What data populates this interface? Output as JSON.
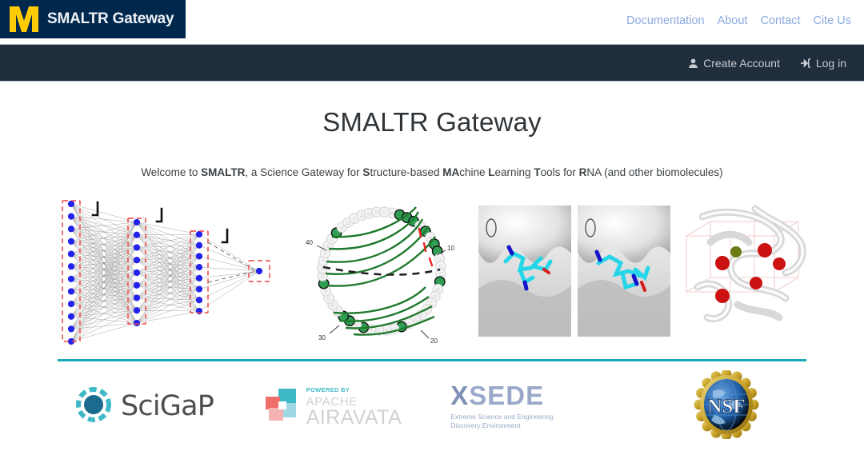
{
  "brand": {
    "logo_icon": "michigan-block-m-icon",
    "logo_text": "SMALTR Gateway",
    "navy": "#00274C",
    "maize": "#FFCB05"
  },
  "topnav": {
    "links": [
      {
        "label": "Documentation",
        "name": "documentation"
      },
      {
        "label": "About",
        "name": "about"
      },
      {
        "label": "Contact",
        "name": "contact"
      },
      {
        "label": "Cite Us",
        "name": "cite-us"
      }
    ],
    "link_color": "#8aa9e0"
  },
  "darknav": {
    "background": "#1f2d3d",
    "items": [
      {
        "label": "Create Account",
        "icon": "user-icon",
        "name": "create-account"
      },
      {
        "label": "Log in",
        "icon": "sign-in-icon",
        "name": "log-in"
      }
    ]
  },
  "main": {
    "page_title": "SMALTR Gateway",
    "welcome": {
      "parts": [
        {
          "text": "Welcome to ",
          "bold": false
        },
        {
          "text": "SMALTR",
          "bold": true
        },
        {
          "text": ", a Science Gateway for ",
          "bold": false
        },
        {
          "text": "S",
          "bold": true
        },
        {
          "text": "tructure-based ",
          "bold": false
        },
        {
          "text": "MA",
          "bold": true
        },
        {
          "text": "chine ",
          "bold": false
        },
        {
          "text": "L",
          "bold": true
        },
        {
          "text": "earning ",
          "bold": false
        },
        {
          "text": "T",
          "bold": true
        },
        {
          "text": "ools for ",
          "bold": false
        },
        {
          "text": "R",
          "bold": true
        },
        {
          "text": "NA (and other biomolecules)",
          "bold": false
        }
      ]
    }
  },
  "hero": {
    "panels": [
      {
        "name": "neural-network-diagram",
        "description": "Fully connected neural network with blue nodes, red dashed layer boxes and ReLU activation glyphs",
        "node_color": "#2222ee",
        "box_color": "#ef4444",
        "layers": [
          12,
          9,
          8,
          1
        ]
      },
      {
        "name": "rna-circular-structure-plot",
        "description": "Circular RNA secondary structure diagram with green base-pair arcs",
        "arc_color": "#1f7a2e",
        "position_labels": [
          "10",
          "20",
          "30",
          "40"
        ],
        "nucleotides": [
          "A",
          "U",
          "G",
          "C"
        ]
      },
      {
        "name": "ligand-binding-pocket-pair",
        "description": "Two grayscale molecular surfaces with cyan stick ligands bound",
        "ligand_color": "#22d3ee"
      },
      {
        "name": "rna-3d-structure-binding-sites",
        "description": "Gray RNA ribbon 3D structure with red binding-site spheres, one green sphere and pink wireframe grid boxes",
        "site_color": "#cc1111",
        "ion_color": "#6b7a12"
      }
    ]
  },
  "footer": {
    "divider_color": "#16a8b5",
    "logos": [
      {
        "name": "scigap-logo",
        "text": "SciGaP",
        "ring_color": "#3fb8c8",
        "core_color": "#1b6b8f"
      },
      {
        "name": "apache-airavata-logo",
        "powered_by": "POWERED BY",
        "line1": "APACHE",
        "line2": "AIRAVATA",
        "colors": {
          "teal": "#3fb8c8",
          "blue": "#5bc0de",
          "red": "#ee6f6a",
          "pale": "#f4b3b0"
        }
      },
      {
        "name": "xsede-logo",
        "word": "XSEDE",
        "word_first": "X",
        "word_rest": "SEDE",
        "tagline_line1": "Extreme Science and Engineering",
        "tagline_line2": "Discovery Environment",
        "color": "#9aa9c9"
      },
      {
        "name": "nsf-logo",
        "text": "NSF",
        "ring_color": "#c9a227",
        "globe_color": "#1f5fa8"
      }
    ]
  }
}
